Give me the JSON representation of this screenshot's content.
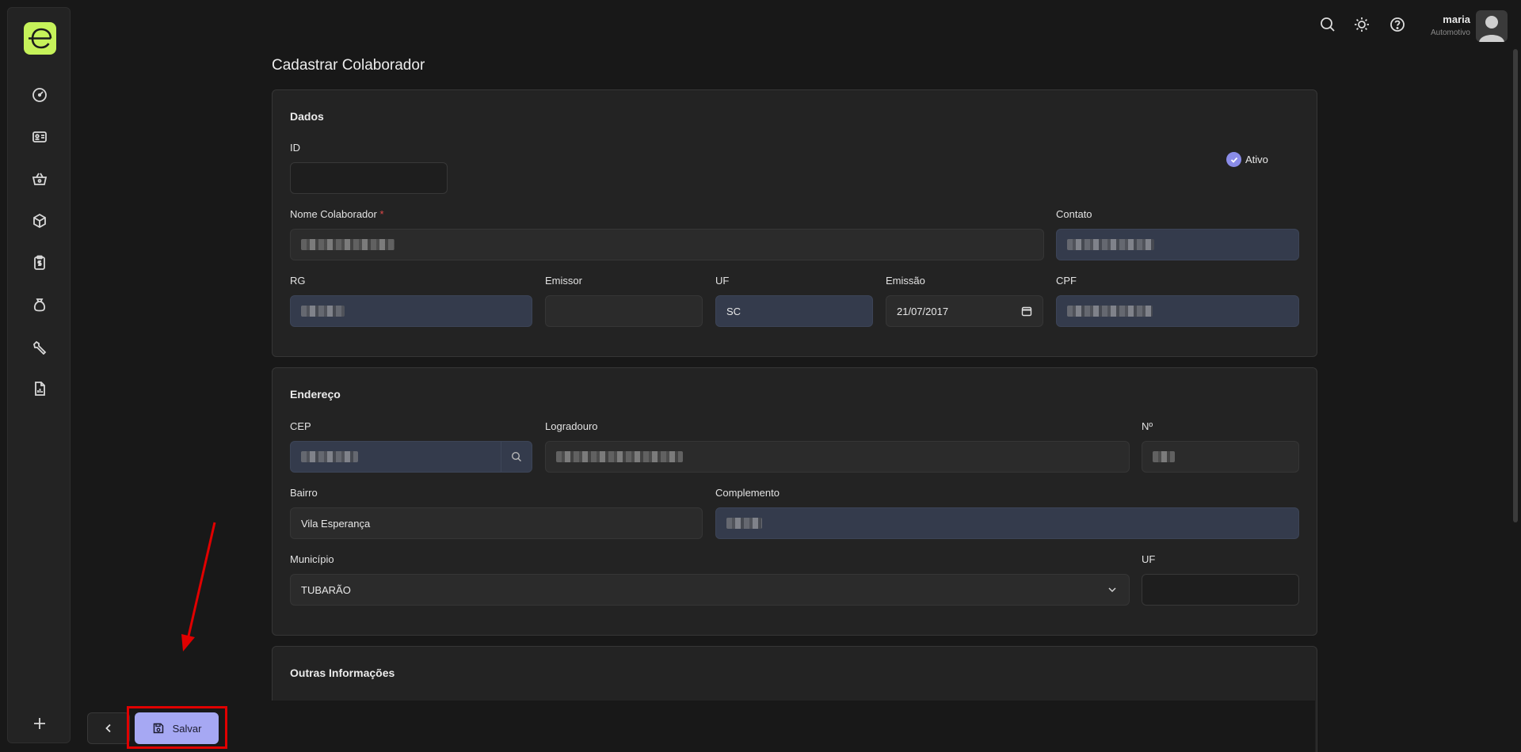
{
  "user": {
    "name": "maria",
    "company": "Automotivo"
  },
  "page_title": "Cadastrar Colaborador",
  "dados": {
    "title": "Dados",
    "id_label": "ID",
    "id_value": "",
    "ativo_label": "Ativo",
    "ativo_checked": true,
    "nome_label": "Nome Colaborador",
    "required_mark": "*",
    "contato_label": "Contato",
    "rg_label": "RG",
    "emissor_label": "Emissor",
    "emissor_value": "",
    "uf_label": "UF",
    "uf_value": "SC",
    "emissao_label": "Emissão",
    "emissao_value": "21/07/2017",
    "cpf_label": "CPF"
  },
  "endereco": {
    "title": "Endereço",
    "cep_label": "CEP",
    "logradouro_label": "Logradouro",
    "numero_label": "Nº",
    "bairro_label": "Bairro",
    "bairro_value": "Vila Esperança",
    "complemento_label": "Complemento",
    "municipio_label": "Município",
    "municipio_value": "TUBARÃO",
    "uf_label": "UF",
    "uf_value": ""
  },
  "outras": {
    "title": "Outras Informações"
  },
  "footer": {
    "save_label": "Salvar"
  },
  "colors": {
    "accent": "#a6a8f3",
    "logo": "#c6f25a",
    "highlight": "#e00000"
  }
}
